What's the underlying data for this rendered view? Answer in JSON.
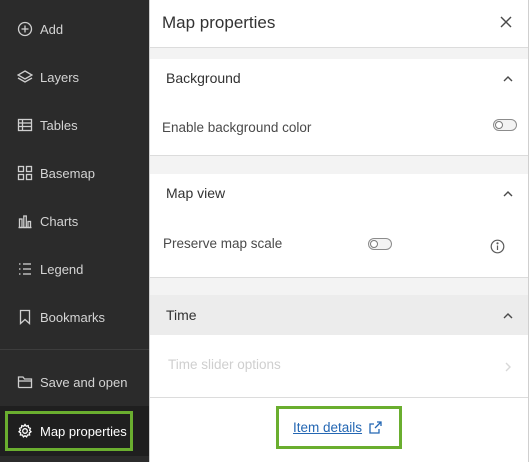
{
  "sidebar": {
    "items": [
      {
        "label": "Add",
        "icon": "add-circle-icon"
      },
      {
        "label": "Layers",
        "icon": "layers-icon"
      },
      {
        "label": "Tables",
        "icon": "table-icon"
      },
      {
        "label": "Basemap",
        "icon": "basemap-icon"
      },
      {
        "label": "Charts",
        "icon": "chart-icon"
      },
      {
        "label": "Legend",
        "icon": "legend-icon"
      },
      {
        "label": "Bookmarks",
        "icon": "bookmark-icon"
      },
      {
        "label": "Save and open",
        "icon": "folder-icon"
      },
      {
        "label": "Map properties",
        "icon": "gear-icon",
        "active": true
      }
    ]
  },
  "panel": {
    "title": "Map properties",
    "sections": {
      "background": {
        "title": "Background",
        "expanded": true,
        "rows": [
          {
            "label": "Enable background color",
            "toggle": false
          }
        ]
      },
      "map_view": {
        "title": "Map view",
        "expanded": true,
        "rows": [
          {
            "label": "Preserve map scale",
            "toggle": false,
            "info_icon": "info-icon"
          }
        ]
      },
      "time": {
        "title": "Time",
        "expanded": true,
        "rows": [
          {
            "label": "Time slider options",
            "disabled": true
          }
        ]
      }
    },
    "footer": {
      "link_label": "Item details",
      "link_icon": "external-link-icon"
    }
  },
  "colors": {
    "sidebar_bg": "#2b2b2b",
    "highlight": "#6aae2f",
    "link": "#2467b3"
  }
}
